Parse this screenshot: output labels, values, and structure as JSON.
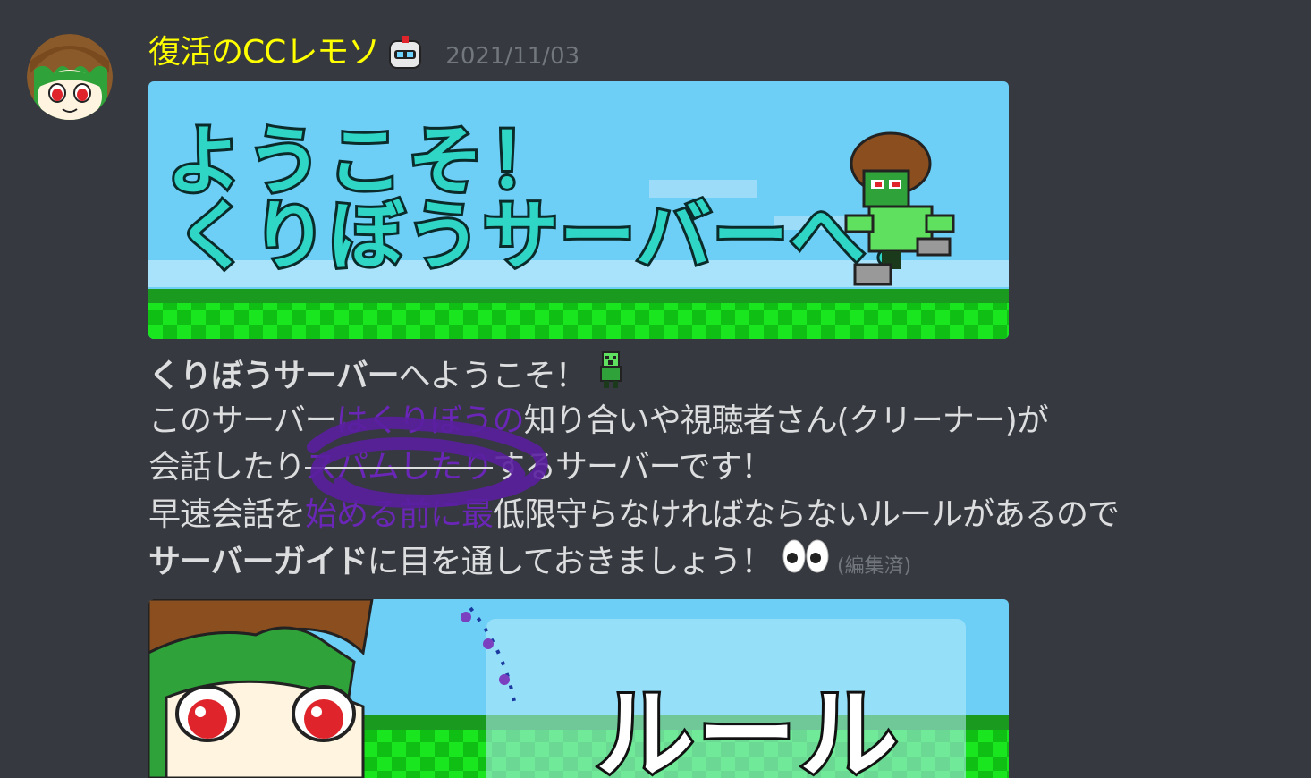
{
  "message": {
    "username": "復活のCCレモソ",
    "timestamp": "2021/11/03",
    "edited_label": "(編集済)",
    "banner1": {
      "line1": "ようこそ！",
      "line2": "くりぼうサーバーへ！"
    },
    "banner2": {
      "title": "ルール"
    },
    "lines": {
      "l1_bold": "くりぼうサーバー",
      "l1_rest": "へようこそ！",
      "l2_a": "このサーバー",
      "l2_b": "はくりぼうの",
      "l2_c": "知り合いや視聴者さん(クリーナー)が",
      "l3_a": "会話したり",
      "l3_b": "スパムしたり",
      "l3_c": "するサーバーです！",
      "l4_a": "早速会話を",
      "l4_b": "始める前に最",
      "l4_c": "低限守らなければならないルールがあるので",
      "l5_bold": "サーバーガイド",
      "l5_rest": "に目を通しておきましょう！"
    }
  },
  "icons": [
    "avatar",
    "bot-badge-icon",
    "creeper-emoji-icon",
    "eyes-emoji-icon"
  ],
  "colors": {
    "background": "#36393f",
    "username": "#ffff00",
    "text": "#dcddde",
    "muted": "#72767d",
    "scribble": "#5a1f9e"
  }
}
